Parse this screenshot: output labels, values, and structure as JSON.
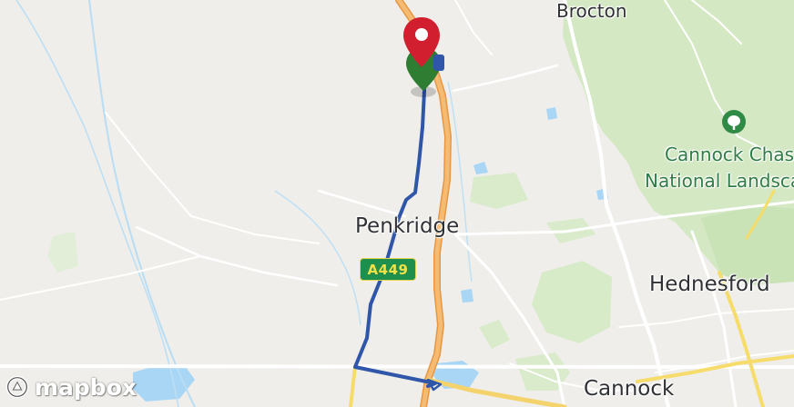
{
  "map": {
    "places": {
      "brocton": "Brocton",
      "cannock_chase": "Cannock Chase",
      "national_landscape": "National Landscape",
      "penkridge": "Penkridge",
      "hednesford": "Hednesford",
      "cannock": "Cannock"
    },
    "road_shield": "A449",
    "attribution_logo": "mapbox",
    "route_color": "#2f56a8",
    "start_marker_color": "#2e7d32",
    "end_marker_color": "#d11f2f",
    "motorway_color": "#f2b36a",
    "park_color": "#cfe6bf"
  }
}
